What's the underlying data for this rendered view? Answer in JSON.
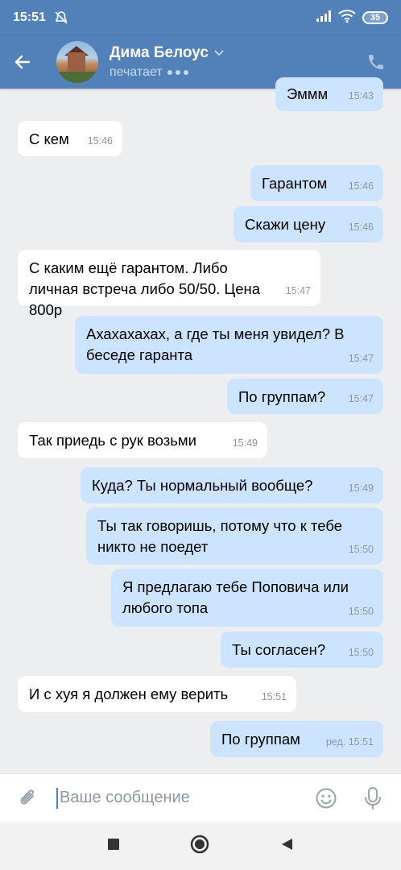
{
  "statusbar": {
    "time": "15:51",
    "battery": "35"
  },
  "header": {
    "name": "Дима Белоус",
    "status": "печатает"
  },
  "messages": [
    {
      "dir": "out",
      "text": "Эммм",
      "time": "15:43"
    },
    {
      "dir": "in",
      "text": "С кем",
      "time": "15:46"
    },
    {
      "dir": "out",
      "text": "Гарантом",
      "time": "15:46"
    },
    {
      "dir": "out",
      "text": "Скажи цену",
      "time": "15:46"
    },
    {
      "dir": "in",
      "text": "С каким ещё гарантом. Либо личная встреча либо 50/50. Цена 800р",
      "time": "15:47"
    },
    {
      "dir": "out",
      "text": "Ахахахахах, а где ты меня увидел?  В беседе гаранта",
      "time": "15:47"
    },
    {
      "dir": "out",
      "text": "По группам?",
      "time": "15:47"
    },
    {
      "dir": "in",
      "text": "Так приедь с рук возьми",
      "time": "15:49"
    },
    {
      "dir": "out",
      "text": "Куда? Ты нормальный вообще?",
      "time": "15:49"
    },
    {
      "dir": "out",
      "text": "Ты так говоришь, потому что к тебе никто не поедет",
      "time": "15:50"
    },
    {
      "dir": "out",
      "text": "Я предлагаю тебе Поповича или любого топа",
      "time": "15:50"
    },
    {
      "dir": "out",
      "text": "Ты согласен?",
      "time": "15:50"
    },
    {
      "dir": "in",
      "text": "И с хуя я должен ему верить",
      "time": "15:51"
    },
    {
      "dir": "out",
      "text": "По группам",
      "time": "ред. 15:51"
    }
  ],
  "input": {
    "placeholder": "Ваше сообщение"
  },
  "colors": {
    "accent": "#5181b8",
    "outgoing": "#cce4ff",
    "incoming": "#ffffff",
    "background": "#edeef0"
  }
}
